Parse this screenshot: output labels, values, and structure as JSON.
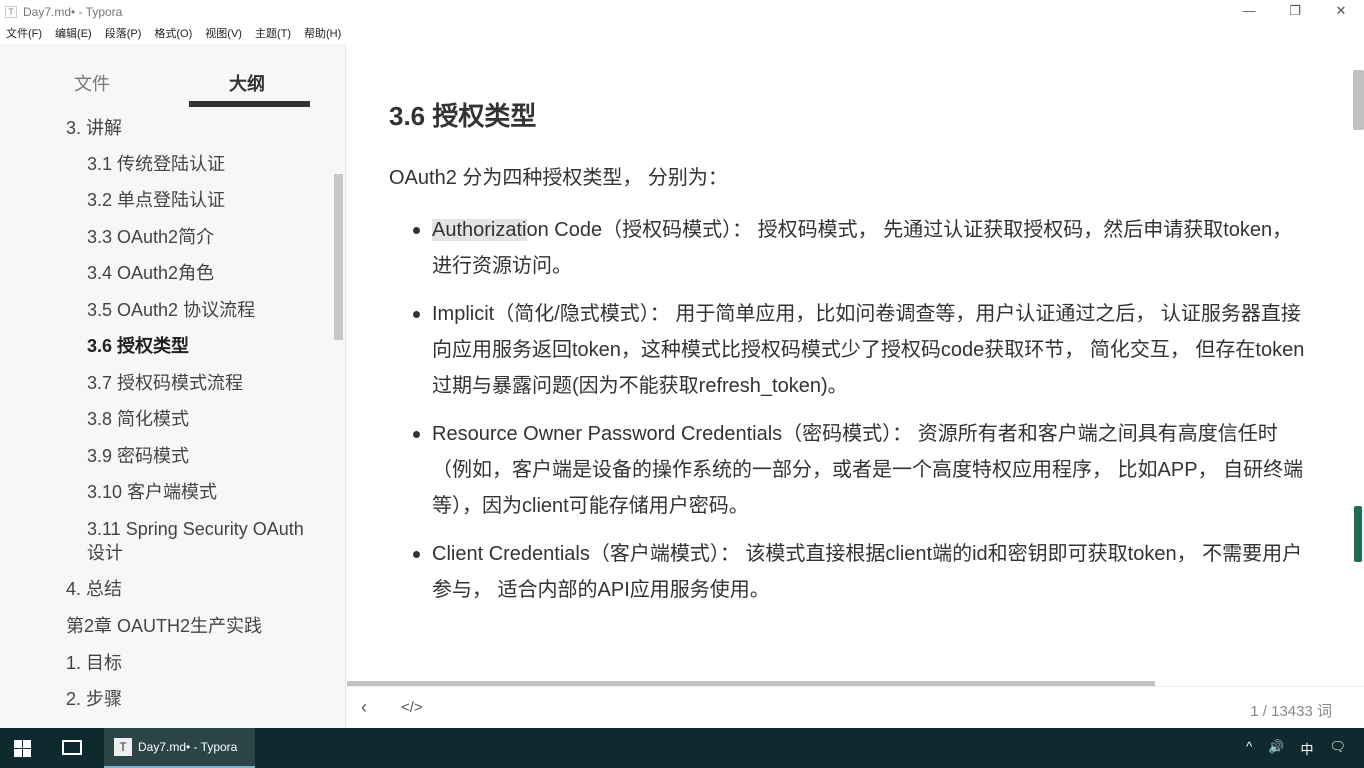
{
  "window": {
    "title": "Day7.md• - Typora",
    "app_icon": "T",
    "controls": {
      "minimize": "—",
      "maximize": "❐",
      "close": "✕"
    }
  },
  "menu": [
    "文件(F)",
    "编辑(E)",
    "段落(P)",
    "格式(O)",
    "视图(V)",
    "主题(T)",
    "帮助(H)"
  ],
  "sidebar": {
    "tabs": [
      "文件",
      "大纲"
    ],
    "active_tab": "大纲",
    "outline": [
      {
        "label": "3. 讲解",
        "level": 1
      },
      {
        "label": "3.1 传统登陆认证",
        "level": 2
      },
      {
        "label": "3.2 单点登陆认证",
        "level": 2
      },
      {
        "label": "3.3 OAuth2简介",
        "level": 2
      },
      {
        "label": "3.4 OAuth2角色",
        "level": 2
      },
      {
        "label": "3.5 OAuth2 协议流程",
        "level": 2
      },
      {
        "label": "3.6 授权类型",
        "level": 2,
        "active": true
      },
      {
        "label": "3.7 授权码模式流程",
        "level": 2
      },
      {
        "label": "3.8 简化模式",
        "level": 2
      },
      {
        "label": "3.9 密码模式",
        "level": 2
      },
      {
        "label": "3.10 客户端模式",
        "level": 2
      },
      {
        "label": "3.11 Spring Security OAuth设计",
        "level": 2
      },
      {
        "label": "4. 总结",
        "level": 1
      },
      {
        "label": "第2章 OAUTH2生产实践",
        "level": 1
      },
      {
        "label": "1. 目标",
        "level": 1
      },
      {
        "label": "2. 步骤",
        "level": 1
      }
    ]
  },
  "content": {
    "heading": "3.6 授权类型",
    "intro": "OAuth2 分为四种授权类型， 分别为：",
    "bullets": [
      {
        "highlight": "Authorizati",
        "text": "on Code（授权码模式）： 授权码模式， 先通过认证获取授权码，然后申请获取token，进行资源访问。"
      },
      {
        "highlight": "",
        "text": "Implicit（简化/隐式模式）： 用于简单应用，比如问卷调查等，用户认证通过之后， 认证服务器直接向应用服务返回token，这种模式比授权码模式少了授权码code获取环节， 简化交互， 但存在token过期与暴露问题(因为不能获取refresh_token)。"
      },
      {
        "highlight": "",
        "text": "Resource Owner Password Credentials（密码模式）： 资源所有者和客户端之间具有高度信任时（例如，客户端是设备的操作系统的一部分，或者是一个高度特权应用程序， 比如APP， 自研终端等），因为client可能存储用户密码。"
      },
      {
        "highlight": "",
        "text": "Client Credentials（客户端模式）： 该模式直接根据client端的id和密钥即可获取token， 不需要用户参与， 适合内部的API应用服务使用。"
      }
    ]
  },
  "footer": {
    "back": "‹",
    "source": "</>",
    "word_count": "1 / 13433 词"
  },
  "taskbar": {
    "app_label": "Day7.md• - Typora",
    "app_icon": "T",
    "tray": [
      "^",
      "🔊",
      "中",
      "🗨"
    ]
  }
}
